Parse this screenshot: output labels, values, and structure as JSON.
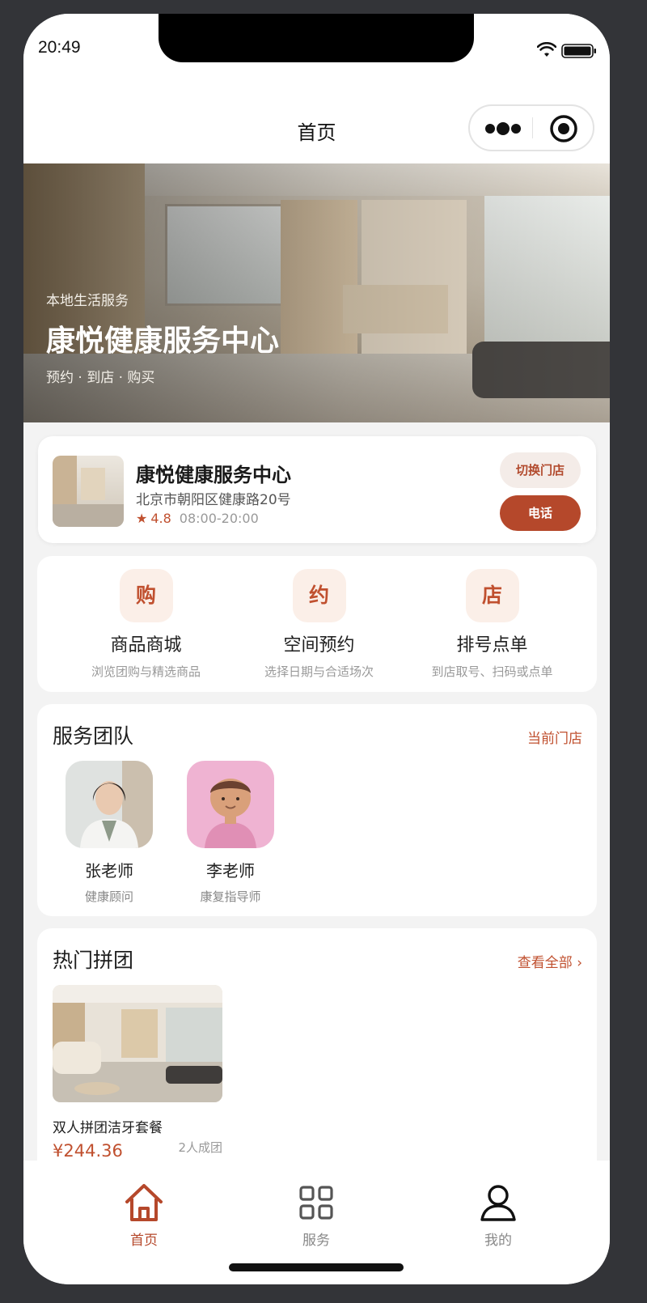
{
  "status_bar": {
    "time": "20:49"
  },
  "nav": {
    "title": "首页"
  },
  "hero": {
    "subtitle": "本地生活服务",
    "title": "康悦健康服务中心",
    "tags": "预约 · 到店 · 购买"
  },
  "store": {
    "name": "康悦健康服务中心",
    "address": "北京市朝阳区健康路20号",
    "rating": "4.8",
    "hours": "08:00-20:00",
    "switch_label": "切换门店",
    "call_label": "电话"
  },
  "entries": [
    {
      "icon_char": "购",
      "title": "商品商城",
      "desc": "浏览团购与精选商品"
    },
    {
      "icon_char": "约",
      "title": "空间预约",
      "desc": "选择日期与合适场次"
    },
    {
      "icon_char": "店",
      "title": "排号点单",
      "desc": "到店取号、扫码或点单"
    }
  ],
  "team": {
    "title": "服务团队",
    "link": "当前门店",
    "members": [
      {
        "name": "张老师",
        "role": "健康顾问"
      },
      {
        "name": "李老师",
        "role": "康复指导师"
      }
    ]
  },
  "group_buy": {
    "title": "热门拼团",
    "link": "查看全部 ›",
    "items": [
      {
        "name": "双人拼团洁牙套餐",
        "price": "¥244.36",
        "group_size": "2人成团"
      }
    ]
  },
  "tabbar": {
    "items": [
      {
        "label": "首页",
        "icon": "home-icon",
        "active": true
      },
      {
        "label": "服务",
        "icon": "grid-icon",
        "active": false
      },
      {
        "label": "我的",
        "icon": "user-icon",
        "active": false
      }
    ]
  },
  "colors": {
    "accent": "#b5482b",
    "accent_light": "#fbefe8",
    "page_bg": "#f3f3f3"
  }
}
